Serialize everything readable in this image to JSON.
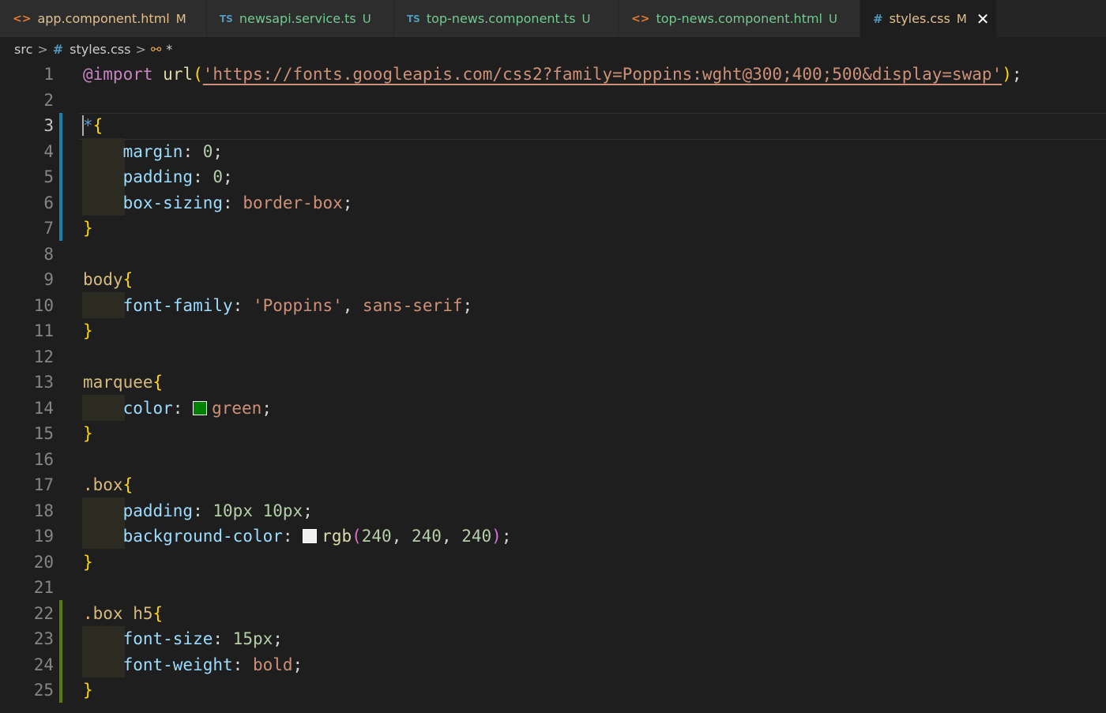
{
  "tabs": [
    {
      "label": "app.component.html",
      "icon": "html-file-icon",
      "icon_glyph": "<>",
      "status": "M",
      "label_color": "#e2c08d",
      "status_color": "#e2c08d"
    },
    {
      "label": "newsapi.service.ts",
      "icon": "typescript-file-icon",
      "icon_glyph": "TS",
      "status": "U",
      "label_color": "#73c991",
      "status_color": "#73c991"
    },
    {
      "label": "top-news.component.ts",
      "icon": "typescript-file-icon",
      "icon_glyph": "TS",
      "status": "U",
      "label_color": "#73c991",
      "status_color": "#73c991"
    },
    {
      "label": "top-news.component.html",
      "icon": "html-file-icon",
      "icon_glyph": "<>",
      "status": "U",
      "label_color": "#73c991",
      "status_color": "#73c991"
    },
    {
      "label": "styles.css",
      "icon": "css-file-icon",
      "icon_glyph": "#",
      "status": "M",
      "label_color": "#e2c08d",
      "status_color": "#e2c08d",
      "active": true,
      "close_glyph": "✕"
    }
  ],
  "breadcrumb": {
    "folder": "src",
    "file_glyph": "#",
    "file": "styles.css",
    "symbol_glyph": "⚯",
    "symbol": "*"
  },
  "editor": {
    "current_line": 3,
    "colors": {
      "green_swatch": "#008000",
      "rgb_swatch": "#f0f0f0",
      "modified_bar": "#1b81a8",
      "added_bar": "#587c0c"
    },
    "lines": {
      "l1": {
        "at": "@import",
        "fn": "url",
        "p1": "(",
        "url": "'https://fonts.googleapis.com/css2?family=Poppins:wght@300;400;500&display=swap'",
        "p2": ")",
        "semi": ";"
      },
      "l3": {
        "star": "*",
        "brace": "{"
      },
      "l4": {
        "prop": "margin",
        "colon": ": ",
        "val": "0",
        "semi": ";"
      },
      "l5": {
        "prop": "padding",
        "colon": ": ",
        "val": "0",
        "semi": ";"
      },
      "l6": {
        "prop": "box-sizing",
        "colon": ": ",
        "val": "border-box",
        "semi": ";"
      },
      "l7": {
        "brace": "}"
      },
      "l9": {
        "sel": "body",
        "brace": "{"
      },
      "l10": {
        "prop": "font-family",
        "colon": ": ",
        "val1": "'Poppins'",
        "comma": ", ",
        "val2": "sans-serif",
        "semi": ";"
      },
      "l11": {
        "brace": "}"
      },
      "l13": {
        "sel": "marquee",
        "brace": "{"
      },
      "l14": {
        "prop": "color",
        "colon": ": ",
        "val": "green",
        "semi": ";"
      },
      "l15": {
        "brace": "}"
      },
      "l17": {
        "sel": ".box",
        "brace": "{"
      },
      "l18": {
        "prop": "padding",
        "colon": ": ",
        "n1": "10px",
        "space": " ",
        "n2": "10px",
        "semi": ";"
      },
      "l19": {
        "prop": "background-color",
        "colon": ": ",
        "fn": "rgb",
        "p1": "(",
        "n1": "240",
        "c1": ", ",
        "n2": "240",
        "c2": ", ",
        "n3": "240",
        "p2": ")",
        "semi": ";"
      },
      "l20": {
        "brace": "}"
      },
      "l22": {
        "sel": ".box h5",
        "brace": "{"
      },
      "l23": {
        "prop": "font-size",
        "colon": ": ",
        "val": "15px",
        "semi": ";"
      },
      "l24": {
        "prop": "font-weight",
        "colon": ": ",
        "val": "bold",
        "semi": ";"
      },
      "l25": {
        "brace": "}"
      }
    }
  }
}
